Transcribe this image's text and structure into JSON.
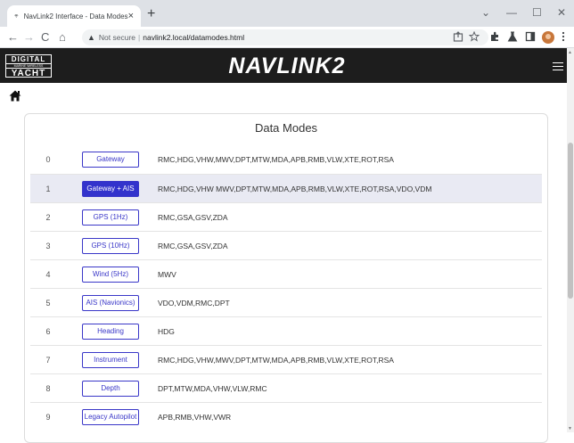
{
  "browser": {
    "tab_title": "NavLink2 Interface - Data Modes",
    "tab_close": "×",
    "new_tab": "+",
    "window_controls": {
      "dropdown": "⌄",
      "minimize": "—",
      "maximize": "☐",
      "close": "✕"
    },
    "nav": {
      "back": "←",
      "forward": "→",
      "reload": "C",
      "home": "⌂"
    },
    "address": {
      "warning_icon": "▲",
      "secure_label": "Not secure",
      "separator": "|",
      "url": "navlink2.local/datamodes.html"
    },
    "toolbar_icons": [
      "share-icon",
      "star-icon",
      "extensions-icon",
      "lab-icon",
      "sidebar-icon",
      "profile-avatar",
      "kebab-menu-icon"
    ]
  },
  "header": {
    "logo": {
      "line1": "DIGITAL",
      "line2": "MARINE WIRELESS",
      "line3": "YACHT"
    },
    "brand": "NAVLINK2"
  },
  "page": {
    "title": "Data Modes",
    "selected_index": 1,
    "modes": [
      {
        "num": "0",
        "label": "Gateway",
        "sentences": "RMC,HDG,VHW,MWV,DPT,MTW,MDA,APB,RMB,VLW,XTE,ROT,RSA"
      },
      {
        "num": "1",
        "label": "Gateway + AIS",
        "sentences": "RMC,HDG,VHW MWV,DPT,MTW,MDA,APB,RMB,VLW,XTE,ROT,RSA,VDO,VDM"
      },
      {
        "num": "2",
        "label": "GPS (1Hz)",
        "sentences": "RMC,GSA,GSV,ZDA"
      },
      {
        "num": "3",
        "label": "GPS (10Hz)",
        "sentences": "RMC,GSA,GSV,ZDA"
      },
      {
        "num": "4",
        "label": "Wind (5Hz)",
        "sentences": "MWV"
      },
      {
        "num": "5",
        "label": "AIS (Navionics)",
        "sentences": "VDO,VDM,RMC,DPT"
      },
      {
        "num": "6",
        "label": "Heading",
        "sentences": "HDG"
      },
      {
        "num": "7",
        "label": "Instrument",
        "sentences": "RMC,HDG,VHW,MWV,DPT,MTW,MDA,APB,RMB,VLW,XTE,ROT,RSA"
      },
      {
        "num": "8",
        "label": "Depth",
        "sentences": "DPT,MTW,MDA,VHW,VLW,RMC"
      },
      {
        "num": "9",
        "label": "Legacy Autopilot",
        "sentences": "APB,RMB,VHW,VWR"
      }
    ]
  },
  "colors": {
    "accent": "#3333cc",
    "header_bg": "#1d1d1d",
    "selected_row": "#e9eaf3"
  }
}
